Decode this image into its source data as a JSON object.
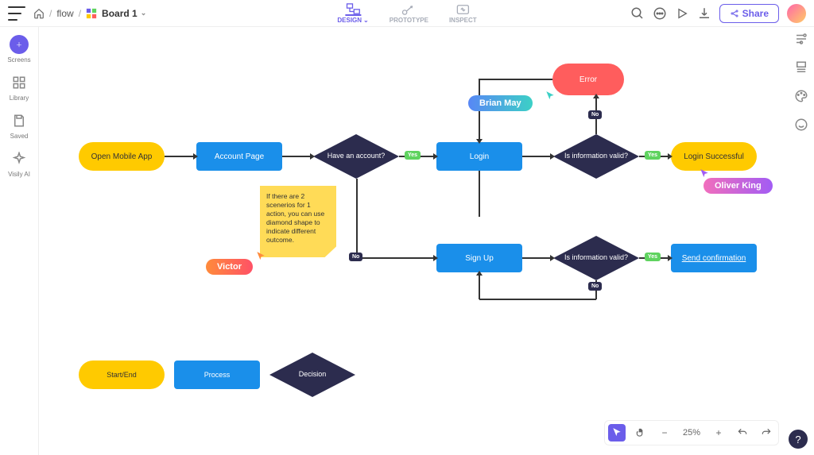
{
  "breadcrumb": {
    "flow": "flow",
    "board": "Board 1"
  },
  "modes": {
    "design": "DESIGN",
    "prototype": "PROTOTYPE",
    "inspect": "INSPECT"
  },
  "share_label": "Share",
  "leftbar": {
    "screens": "Screens",
    "library": "Library",
    "saved": "Saved",
    "visily": "Visily AI"
  },
  "nodes": {
    "open_app": "Open Mobile App",
    "account_page": "Account Page",
    "have_account": "Have an account?",
    "login": "Login",
    "info_valid1": "Is information valid?",
    "error": "Error",
    "login_success": "Login Successful",
    "sign_up": "Sign Up",
    "info_valid2": "Is information valid?",
    "send_conf": "Send confirmation"
  },
  "sticky_note": "If there are 2 scenerios for 1 action, you can use diamond shape to indicate different outcome.",
  "badges": {
    "yes": "Yes",
    "no": "No"
  },
  "users": {
    "brian": "Brian May",
    "victor": "Victor",
    "oliver": "Oliver King"
  },
  "legend": {
    "startend": "Start/End",
    "process": "Process",
    "decision": "Decision"
  },
  "zoom": "25%"
}
